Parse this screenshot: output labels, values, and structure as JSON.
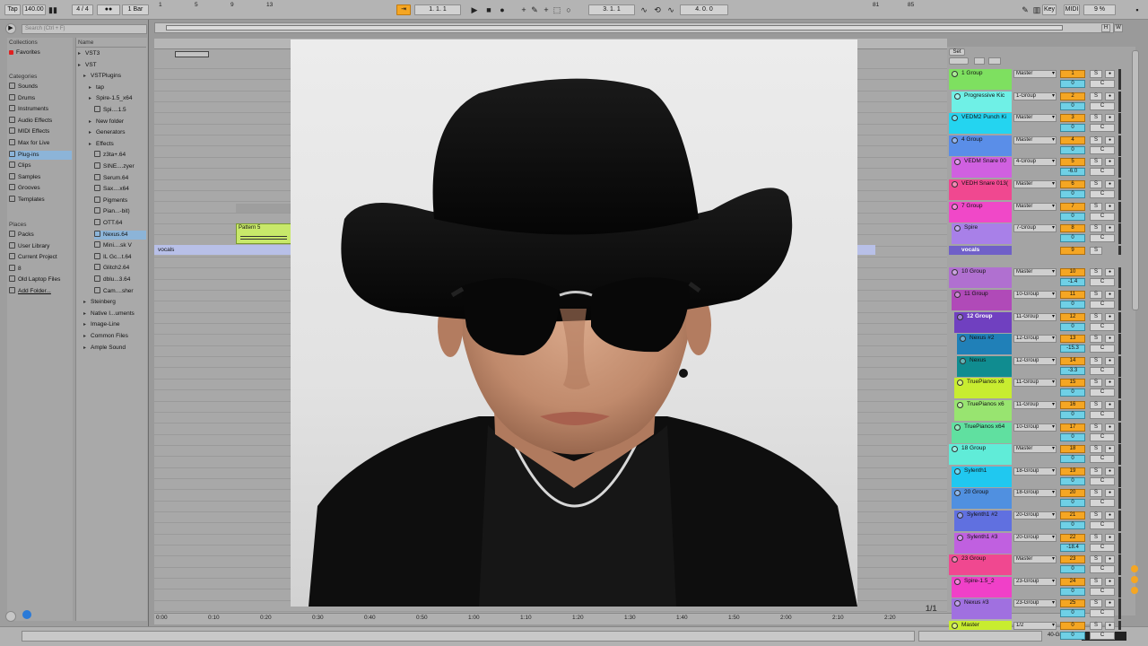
{
  "colors": {
    "orange": "#f5a623",
    "selected": "#8cb4d8",
    "clip_green": "#c8e86a",
    "vocals": "#b8c0e8",
    "volume": "#6fd0e6"
  },
  "topbar": {
    "tap": "Tap",
    "tempo": "140.00",
    "signature": "4 / 4",
    "quantize": "1 Bar",
    "position": "1. 1. 1",
    "loop_start": "3. 1. 1",
    "loop_length": "4. 0. 0",
    "key": "Key",
    "midi": "MIDI",
    "cpu": "9 %"
  },
  "browser": {
    "search_placeholder": "Search (Ctrl + F)",
    "collections_header": "Collections",
    "favorites": "Favorites",
    "categories_header": "Categories",
    "categories": [
      "Sounds",
      "Drums",
      "Instruments",
      "Audio Effects",
      "MIDI Effects",
      "Max for Live",
      "Plug-ins",
      "Clips",
      "Samples",
      "Grooves",
      "Templates"
    ],
    "places_header": "Places",
    "places": [
      "Packs",
      "User Library",
      "Current Project",
      "8",
      "Old Laptop Files",
      "Add Folder..."
    ],
    "name_header": "Name",
    "tree": [
      "VST3",
      "VST",
      "VSTPlugins",
      "tap",
      "Spire-1.5_x64",
      "Spi....1.5",
      "New folder",
      "Generators",
      "Effects",
      "z3ta+.64",
      "SINE....zyer",
      "Serum.64",
      "Sax....x64",
      "Pigments",
      "Pian...-bit)",
      "OTT.64",
      "Nexus.64",
      "Mini....sk V",
      "IL Gc...t.64",
      "Glitch2.64",
      "dblu...3.64",
      "Cam....sher",
      "Steinberg",
      "Native I...uments",
      "Image-Line",
      "Common Files",
      "Ample Sound"
    ]
  },
  "ruler": [
    "1",
    "5",
    "9",
    "13",
    "81",
    "85"
  ],
  "timeline": [
    "0:00",
    "0:10",
    "0:20",
    "0:30",
    "0:40",
    "0:50",
    "1:00",
    "1:10",
    "1:20",
    "1:30",
    "1:40",
    "1:50",
    "2:00",
    "2:10",
    "2:20"
  ],
  "arrangement": {
    "clip_label": "Pattern 5",
    "vocals_label": "vocals",
    "set_label": "Set"
  },
  "tracks": [
    {
      "name": "1 Group",
      "color": "#7ee060",
      "route": "Master",
      "num": "1",
      "vol": "0"
    },
    {
      "name": "Progressive Kic",
      "color": "#6ff0e6",
      "route": "1-Group",
      "num": "2",
      "vol": "0"
    },
    {
      "name": "VEDM2 Punch Ki",
      "color": "#24d4f0",
      "route": "Master",
      "num": "3",
      "vol": "0"
    },
    {
      "name": "4 Group",
      "color": "#5a8ee8",
      "route": "Master",
      "num": "4",
      "vol": "0"
    },
    {
      "name": "VEDM Snare 00",
      "color": "#d060e0",
      "route": "4-Group",
      "num": "5",
      "vol": "-6.0"
    },
    {
      "name": "VEDH Snare 013(",
      "color": "#f04890",
      "route": "Master",
      "num": "6",
      "vol": "0"
    },
    {
      "name": "7 Group",
      "color": "#f048c8",
      "route": "Master",
      "num": "7",
      "vol": "0"
    },
    {
      "name": "Spire",
      "color": "#a880e8",
      "route": "7-Group",
      "num": "8",
      "vol": "0"
    },
    {
      "name": "vocals",
      "color": "#7060c8",
      "route": "",
      "num": "9",
      "vol": ""
    },
    {
      "name": "10 Group",
      "color": "#b070d0",
      "route": "Master",
      "num": "10",
      "vol": "-1.4"
    },
    {
      "name": "11 Group",
      "color": "#b04ab8",
      "route": "10-Group",
      "num": "11",
      "vol": "0"
    },
    {
      "name": "12 Group",
      "color": "#7040c0",
      "route": "11-Group",
      "num": "12",
      "vol": "0"
    },
    {
      "name": "Nexus #2",
      "color": "#2080b8",
      "route": "12-Group",
      "num": "13",
      "vol": "-15.3"
    },
    {
      "name": "Nexus",
      "color": "#108c90",
      "route": "12-Group",
      "num": "14",
      "vol": "-3.3"
    },
    {
      "name": "TruePianos x6",
      "color": "#c8ec30",
      "route": "11-Group",
      "num": "15",
      "vol": "0"
    },
    {
      "name": "TruePianos x6",
      "color": "#98e470",
      "route": "11-Group",
      "num": "16",
      "vol": "0"
    },
    {
      "name": "TruePianos x64",
      "color": "#60e0a0",
      "route": "10-Group",
      "num": "17",
      "vol": "0"
    },
    {
      "name": "18 Group",
      "color": "#60ecd8",
      "route": "Master",
      "num": "18",
      "vol": "0"
    },
    {
      "name": "Sylenth1",
      "color": "#20c8f0",
      "route": "18-Group",
      "num": "19",
      "vol": "0"
    },
    {
      "name": "20 Group",
      "color": "#5090e0",
      "route": "18-Group",
      "num": "20",
      "vol": "0"
    },
    {
      "name": "Sylenth1 #2",
      "color": "#6070e0",
      "route": "20-Group",
      "num": "21",
      "vol": "0"
    },
    {
      "name": "Sylenth1 #3",
      "color": "#c060e0",
      "route": "20-Group",
      "num": "22",
      "vol": "-18.4"
    },
    {
      "name": "23 Group",
      "color": "#f04890",
      "route": "Master",
      "num": "23",
      "vol": "0"
    },
    {
      "name": "Spire-1.5_2",
      "color": "#f040c8",
      "route": "23-Group",
      "num": "24",
      "vol": "0"
    },
    {
      "name": "Nexus #3",
      "color": "#a070e0",
      "route": "23-Group",
      "num": "25",
      "vol": "0"
    },
    {
      "name": "Master",
      "color": "#c8ec30",
      "route": "1/2",
      "num": "0",
      "vol": "0"
    }
  ],
  "mixer_labels": {
    "solo": "S",
    "cue": "C",
    "page": "1/1"
  },
  "status": {
    "group_label": "40-Group"
  }
}
